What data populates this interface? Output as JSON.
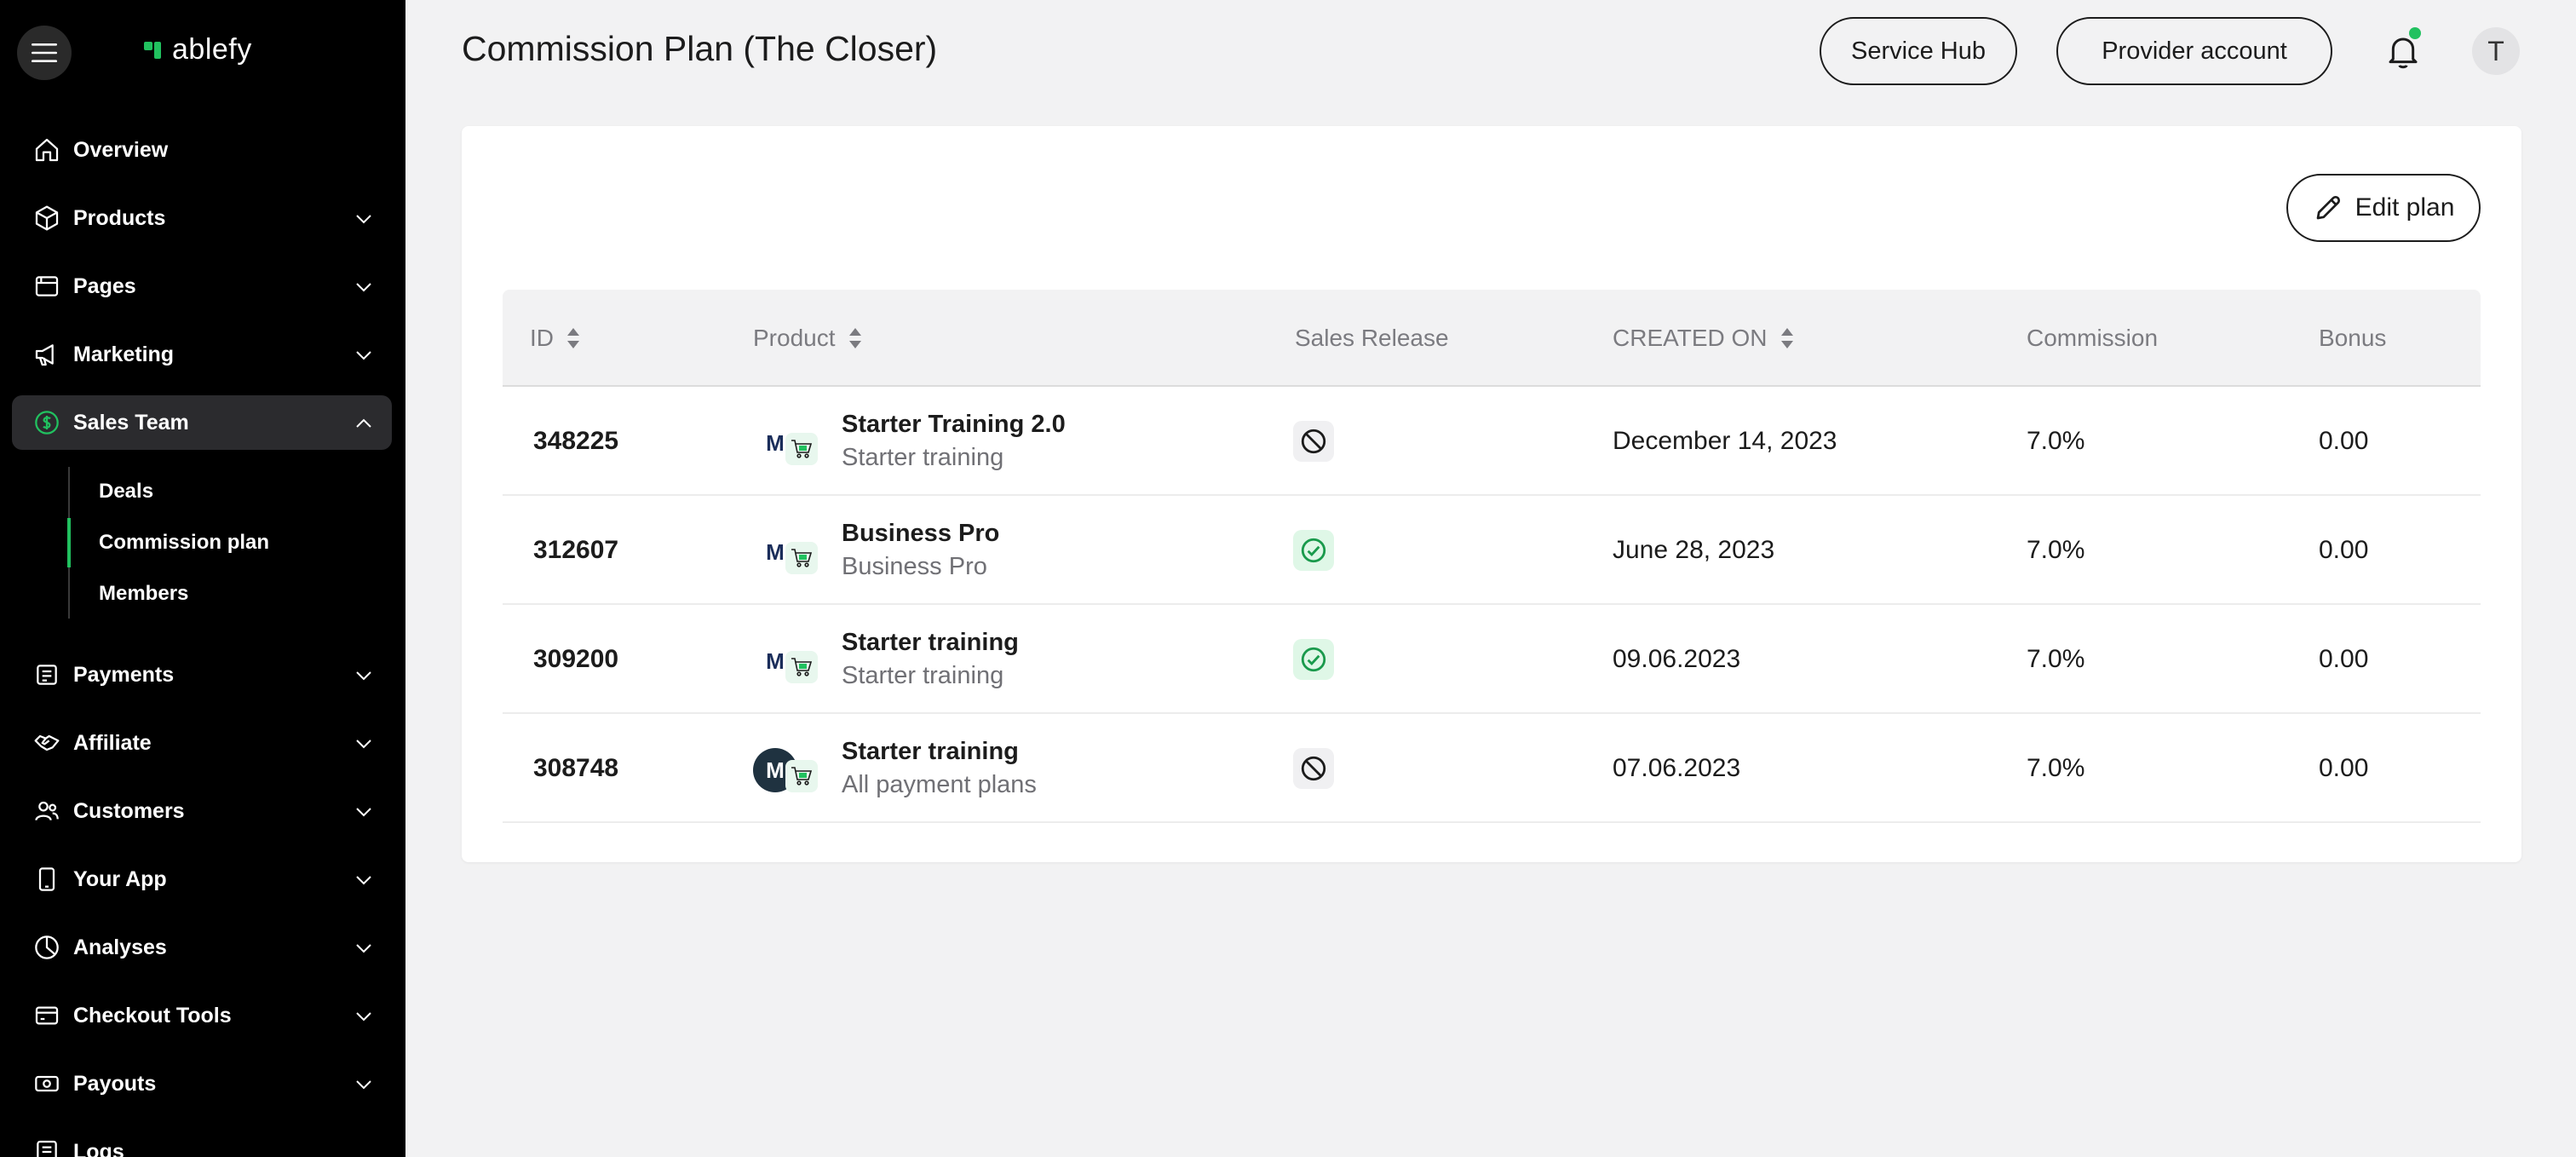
{
  "sidebar": {
    "logo_text": "ablefy",
    "items": [
      {
        "label": "Overview",
        "icon": "home-icon"
      },
      {
        "label": "Products",
        "icon": "box-icon"
      },
      {
        "label": "Pages",
        "icon": "page-icon"
      },
      {
        "label": "Marketing",
        "icon": "megaphone-icon"
      },
      {
        "label": "Sales Team",
        "icon": "dollar-circle-icon"
      },
      {
        "label": "Payments",
        "icon": "receipt-icon"
      },
      {
        "label": "Affiliate",
        "icon": "handshake-icon"
      },
      {
        "label": "Customers",
        "icon": "users-icon"
      },
      {
        "label": "Your App",
        "icon": "phone-icon"
      },
      {
        "label": "Analyses",
        "icon": "pie-chart-icon"
      },
      {
        "label": "Checkout Tools",
        "icon": "checkout-icon"
      },
      {
        "label": "Payouts",
        "icon": "cash-icon"
      },
      {
        "label": "Logs",
        "icon": "log-icon"
      }
    ],
    "sales_team_sub": [
      {
        "label": "Deals"
      },
      {
        "label": "Commission plan"
      },
      {
        "label": "Members"
      }
    ]
  },
  "header": {
    "title": "Commission Plan (The Closer)",
    "service_hub_label": "Service Hub",
    "provider_account_label": "Provider account",
    "avatar_initial": "T"
  },
  "card": {
    "edit_label": "Edit plan"
  },
  "table": {
    "columns": [
      "ID",
      "Product",
      "Sales Release",
      "CREATED ON",
      "Commission",
      "Bonus"
    ],
    "rows": [
      {
        "id": "348225",
        "name": "Starter Training 2.0",
        "sub": "Starter training",
        "release": "blocked",
        "created": "December 14, 2023",
        "commission": "7.0%",
        "bonus": "0.00"
      },
      {
        "id": "312607",
        "name": "Business Pro",
        "sub": "Business Pro",
        "release": "released",
        "created": "June 28, 2023",
        "commission": "7.0%",
        "bonus": "0.00"
      },
      {
        "id": "309200",
        "name": "Starter training",
        "sub": "Starter training",
        "release": "released",
        "created": "09.06.2023",
        "commission": "7.0%",
        "bonus": "0.00"
      },
      {
        "id": "308748",
        "name": "Starter training",
        "sub": "All payment plans",
        "release": "blocked",
        "created": "07.06.2023",
        "commission": "7.0%",
        "bonus": "0.00"
      }
    ]
  },
  "colors": {
    "accent_green": "#21c15f",
    "sidebar_bg": "#000000",
    "page_bg": "#f2f2f3"
  }
}
